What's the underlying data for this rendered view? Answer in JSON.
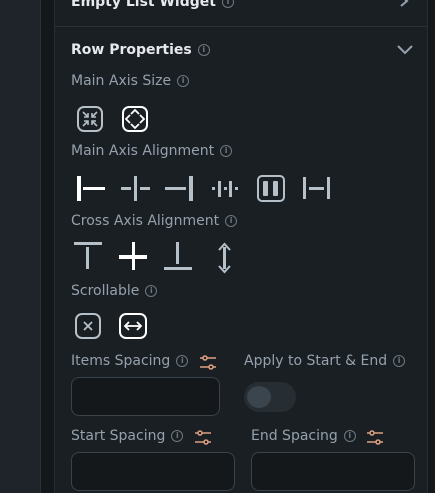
{
  "collapsed_section": {
    "title": "Empty List Widget"
  },
  "section": {
    "title": "Row Properties",
    "main_axis_size": {
      "label": "Main Axis Size",
      "options": [
        "min",
        "max"
      ],
      "selected": "max"
    },
    "main_axis_alignment": {
      "label": "Main Axis Alignment",
      "options": [
        "start",
        "center",
        "end",
        "space-between",
        "space-around",
        "space-evenly"
      ],
      "selected": "start"
    },
    "cross_axis_alignment": {
      "label": "Cross Axis Alignment",
      "options": [
        "start",
        "center",
        "end",
        "stretch"
      ],
      "selected": "center"
    },
    "scrollable": {
      "label": "Scrollable",
      "options": [
        "off",
        "on"
      ],
      "selected": "on"
    },
    "items_spacing": {
      "label": "Items Spacing",
      "value": ""
    },
    "apply_to_start_end": {
      "label": "Apply to Start & End",
      "enabled": false
    },
    "start_spacing": {
      "label": "Start Spacing",
      "value": ""
    },
    "end_spacing": {
      "label": "End Spacing",
      "value": ""
    }
  },
  "colors": {
    "accent_icon": "#e0a180",
    "panel_bg": "#1a1f24"
  }
}
